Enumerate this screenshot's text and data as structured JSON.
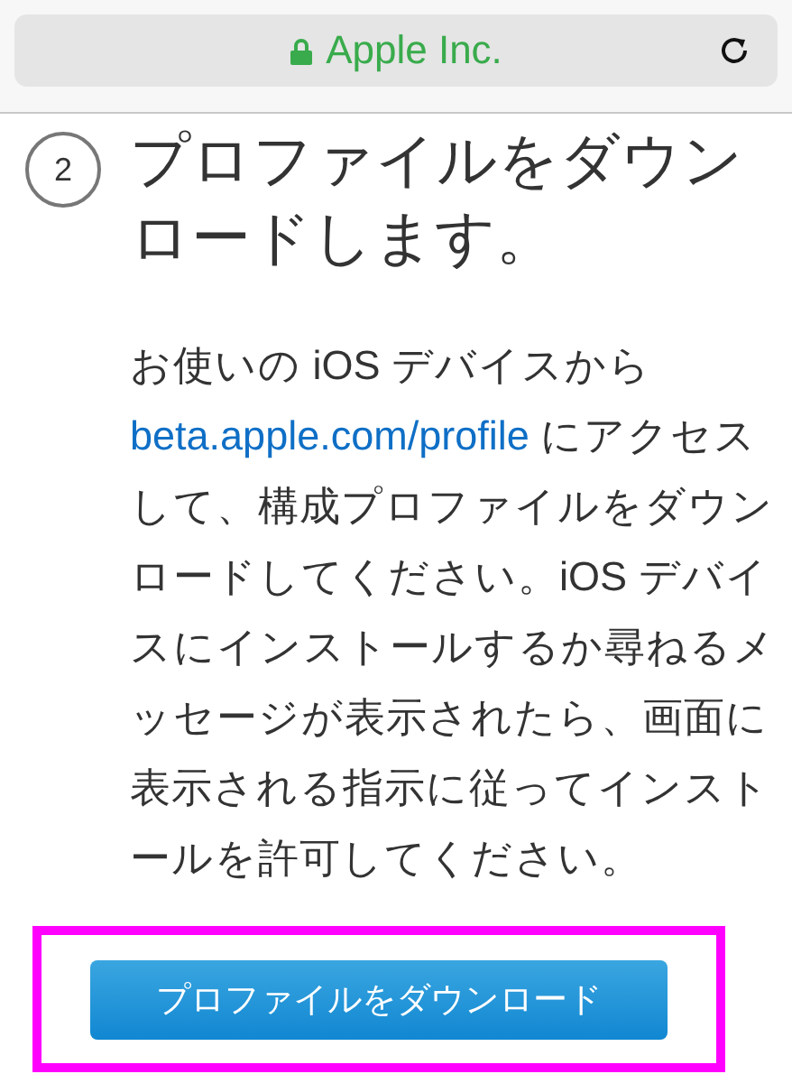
{
  "address_bar": {
    "site": "Apple Inc.",
    "secure": true
  },
  "step": {
    "number": "2",
    "title": "プロファイルをダウンロードします。"
  },
  "instructions": {
    "before": "お使いの iOS デバイスから ",
    "link": "beta.apple.com/profile",
    "after": " にアクセスして、構成プロファイルをダウンロードしてください。iOS デバイスにインストールするか尋ねるメッセージが表示されたら、画面に表示される指示に従ってインストールを許可してください。"
  },
  "download_button": {
    "label": "プロファイルをダウンロード",
    "highlighted": true
  }
}
